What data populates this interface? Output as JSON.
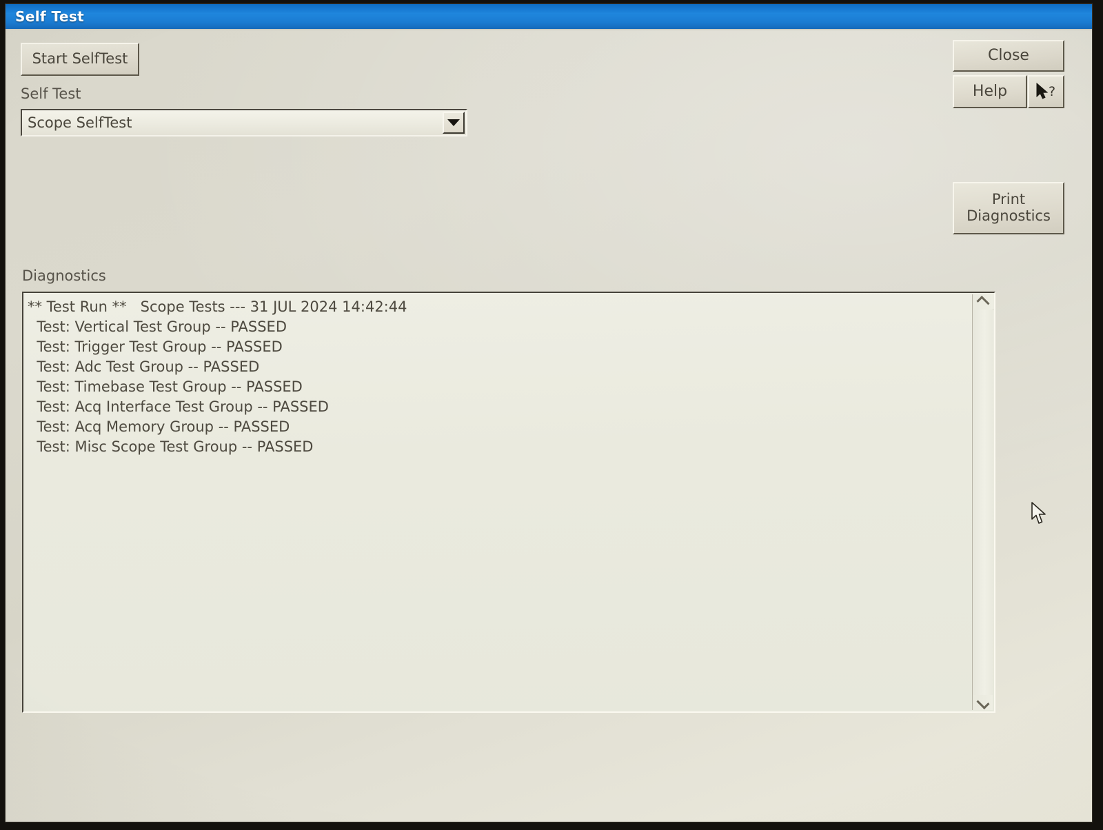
{
  "window": {
    "title": "Self Test"
  },
  "toolbar": {
    "start_selftest_label": "Start SelfTest",
    "close_label": "Close",
    "help_label": "Help",
    "context_help_icon": "pointer-question-icon",
    "print_diagnostics_line1": "Print",
    "print_diagnostics_line2": "Diagnostics"
  },
  "form": {
    "selftest_label": "Self Test",
    "selftest_selected": "Scope SelfTest",
    "selftest_options": [
      "Scope SelfTest"
    ],
    "dropdown_icon": "chevron-down-icon"
  },
  "diagnostics": {
    "label": "Diagnostics",
    "header": "** Test Run **   Scope Tests --- 31 JUL 2024 14:42:44",
    "run_date": "31 JUL 2024",
    "run_time": "14:42:44",
    "test_suite": "Scope Tests",
    "lines": [
      "** Test Run **   Scope Tests --- 31 JUL 2024 14:42:44",
      "  Test: Vertical Test Group -- PASSED",
      "  Test: Trigger Test Group -- PASSED",
      "  Test: Adc Test Group -- PASSED",
      "  Test: Timebase Test Group -- PASSED",
      "  Test: Acq Interface Test Group -- PASSED",
      "  Test: Acq Memory Group -- PASSED",
      "  Test: Misc Scope Test Group -- PASSED"
    ],
    "text": "** Test Run **   Scope Tests --- 31 JUL 2024 14:42:44\n  Test: Vertical Test Group -- PASSED\n  Test: Trigger Test Group -- PASSED\n  Test: Adc Test Group -- PASSED\n  Test: Timebase Test Group -- PASSED\n  Test: Acq Interface Test Group -- PASSED\n  Test: Acq Memory Group -- PASSED\n  Test: Misc Scope Test Group -- PASSED",
    "results": [
      {
        "name": "Vertical Test Group",
        "status": "PASSED"
      },
      {
        "name": "Trigger Test Group",
        "status": "PASSED"
      },
      {
        "name": "Adc Test Group",
        "status": "PASSED"
      },
      {
        "name": "Timebase Test Group",
        "status": "PASSED"
      },
      {
        "name": "Acq Interface Test Group",
        "status": "PASSED"
      },
      {
        "name": "Acq Memory Group",
        "status": "PASSED"
      },
      {
        "name": "Misc Scope Test Group",
        "status": "PASSED"
      }
    ],
    "scrollbar": {
      "up_icon": "chevron-up-icon",
      "down_icon": "chevron-down-icon"
    }
  },
  "colors": {
    "titlebar": "#1b7cd2",
    "titlebar_text": "#ffffff",
    "window_background": "#dbd9cd",
    "text_area_background": "#eaeade",
    "body_text": "#4e4a40"
  },
  "cursor": {
    "icon": "mouse-pointer-icon"
  }
}
